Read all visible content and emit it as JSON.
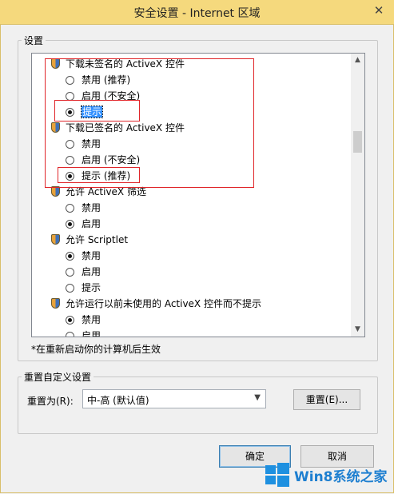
{
  "window": {
    "title": "安全设置 - Internet 区域",
    "close_glyph": "✕"
  },
  "settings_group": {
    "label": "设置"
  },
  "list": {
    "rows": [
      {
        "kind": "category",
        "label": "下载未签名的 ActiveX 控件"
      },
      {
        "kind": "option",
        "label": "禁用 (推荐)",
        "checked": false
      },
      {
        "kind": "option",
        "label": "启用 (不安全)",
        "checked": false
      },
      {
        "kind": "option",
        "label": "提示",
        "checked": true,
        "selected": true
      },
      {
        "kind": "category",
        "label": "下载已签名的 ActiveX 控件"
      },
      {
        "kind": "option",
        "label": "禁用",
        "checked": false
      },
      {
        "kind": "option",
        "label": "启用 (不安全)",
        "checked": false
      },
      {
        "kind": "option",
        "label": "提示 (推荐)",
        "checked": true
      },
      {
        "kind": "category",
        "label": "允许 ActiveX 筛选"
      },
      {
        "kind": "option",
        "label": "禁用",
        "checked": false
      },
      {
        "kind": "option",
        "label": "启用",
        "checked": true
      },
      {
        "kind": "category",
        "label": "允许 Scriptlet"
      },
      {
        "kind": "option",
        "label": "禁用",
        "checked": true
      },
      {
        "kind": "option",
        "label": "启用",
        "checked": false
      },
      {
        "kind": "option",
        "label": "提示",
        "checked": false
      },
      {
        "kind": "category",
        "label": "允许运行以前未使用的 ActiveX 控件而不提示"
      },
      {
        "kind": "option",
        "label": "禁用",
        "checked": true
      },
      {
        "kind": "option",
        "label": "启用",
        "checked": false
      }
    ],
    "scroll_up": "▲",
    "scroll_down": "▼"
  },
  "restart_note": "*在重新启动你的计算机后生效",
  "reset_group": {
    "label": "重置自定义设置",
    "reset_to_label": "重置为(R):",
    "selected_level": "中-高 (默认值)",
    "reset_button": "重置(E)..."
  },
  "buttons": {
    "ok": "确定",
    "cancel": "取消"
  },
  "watermark": {
    "text": "Win8系统之家"
  },
  "colors": {
    "highlight_box": "#e0262a",
    "selection": "#3390ff",
    "titlebar": "#f5d97d"
  }
}
